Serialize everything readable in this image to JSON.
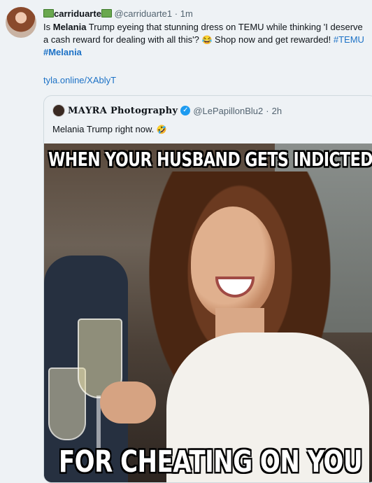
{
  "tweet": {
    "display_name": "carriduarte",
    "handle": "@carriduarte1",
    "separator": "·",
    "time": "1m",
    "text_parts": {
      "p1": "Is ",
      "p2": "Melania",
      "p3": " Trump eyeing that stunning dress on TEMU while thinking 'I deserve a cash reward for dealing with all this'? ",
      "emoji1": "😂",
      "p4": " Shop now and get rewarded! ",
      "tag1": "#TEMU",
      "tag2": "#Melania"
    },
    "link": "tyla.online/XAblyT"
  },
  "quoted": {
    "display_name": "ΜΑΥRΑ Photography",
    "handle": "@LePapillonBlu2",
    "separator": "·",
    "time": "2h",
    "text": "Melania Trump right now. ",
    "emoji": "🤣",
    "meme": {
      "caption_top": "WHEN YOUR HUSBAND  GETS INDICTED",
      "caption_bottom": "FOR CHEATING  ON YOU"
    }
  }
}
